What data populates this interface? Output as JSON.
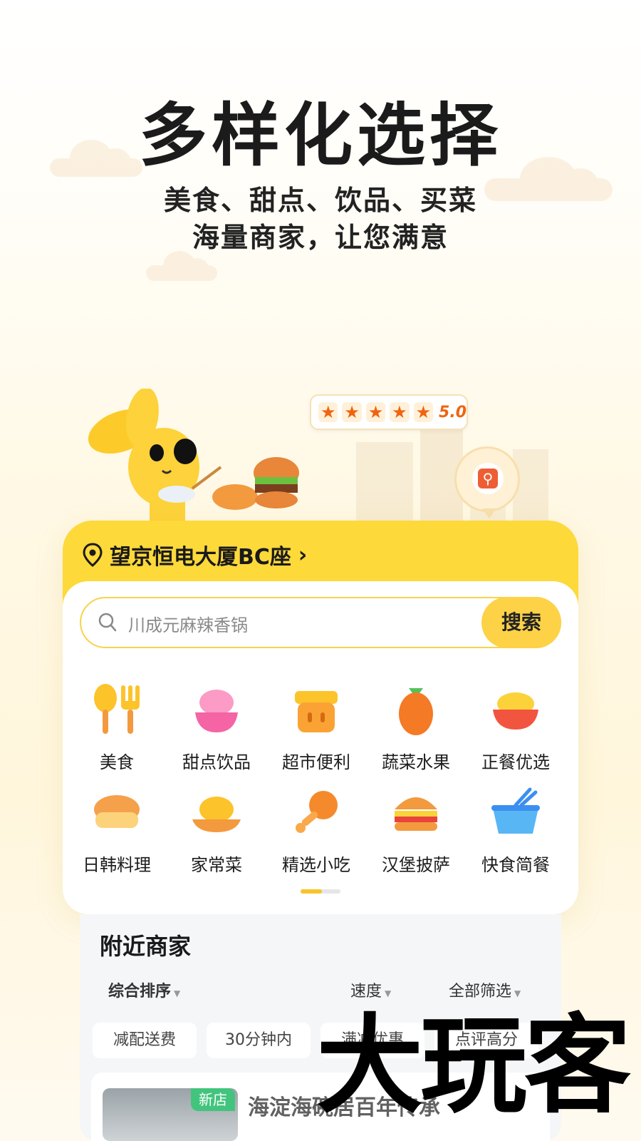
{
  "hero": {
    "title": "多样化选择",
    "subtitle_line1": "美食、甜点、饮品、买菜",
    "subtitle_line2": "海量商家，让您满意"
  },
  "rating": {
    "stars": 5,
    "score": "5.0"
  },
  "location": {
    "address": "望京恒电大厦BC座",
    "chevron": "›",
    "icon": "location-pin-icon"
  },
  "search": {
    "placeholder": "川成元麻辣香锅",
    "button_label": "搜索",
    "icon": "search-icon"
  },
  "categories": [
    {
      "label": "美食",
      "icon": "spoon-fork-icon"
    },
    {
      "label": "甜点饮品",
      "icon": "dessert-bowl-icon"
    },
    {
      "label": "超市便利",
      "icon": "shopping-basket-icon"
    },
    {
      "label": "蔬菜水果",
      "icon": "carrot-icon"
    },
    {
      "label": "正餐优选",
      "icon": "rice-bowl-icon"
    },
    {
      "label": "日韩料理",
      "icon": "sushi-icon"
    },
    {
      "label": "家常菜",
      "icon": "home-dish-icon"
    },
    {
      "label": "精选小吃",
      "icon": "drumstick-icon"
    },
    {
      "label": "汉堡披萨",
      "icon": "burger-icon"
    },
    {
      "label": "快食简餐",
      "icon": "takeout-box-icon"
    }
  ],
  "nearby": {
    "title": "附近商家",
    "sort_options": [
      "综合排序",
      "速度",
      "全部筛选"
    ],
    "chips": [
      "减配送费",
      "30分钟内",
      "满减优惠",
      "点评高分"
    ],
    "shop": {
      "badge": "新店",
      "name": "海淀海碗居百年传承"
    }
  },
  "watermark": "大玩客",
  "colors": {
    "brand_yellow": "#fdd93a",
    "accent_orange": "#f06410",
    "new_badge_green": "#43c47d"
  }
}
